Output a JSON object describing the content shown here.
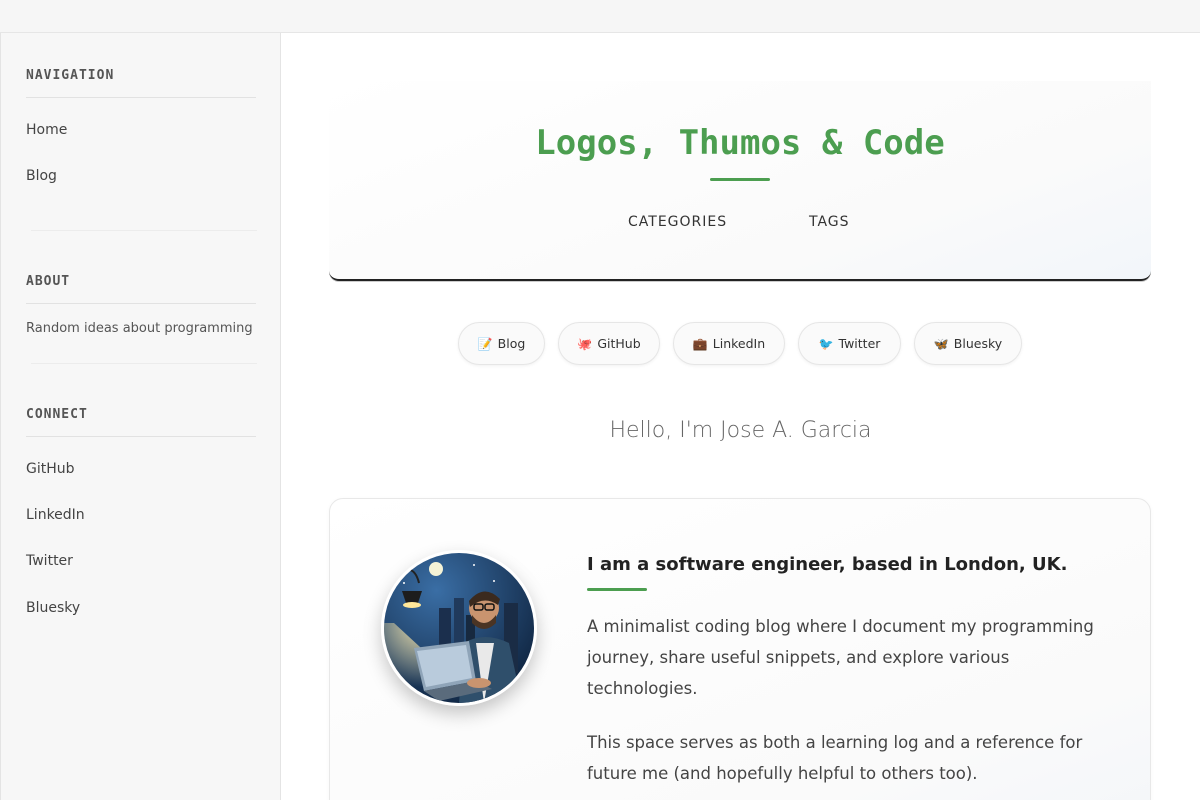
{
  "sidebar": {
    "navigation": {
      "heading": "NAVIGATION",
      "items": [
        "Home",
        "Blog"
      ]
    },
    "about": {
      "heading": "ABOUT",
      "text": "Random ideas about programming"
    },
    "connect": {
      "heading": "CONNECT",
      "items": [
        "GitHub",
        "LinkedIn",
        "Twitter",
        "Bluesky"
      ]
    }
  },
  "header": {
    "title": "Logos, Thumos & Code",
    "nav": [
      "CATEGORIES",
      "TAGS"
    ]
  },
  "social_pills": [
    {
      "icon": "📝",
      "icon_name": "memo-icon",
      "label": "Blog"
    },
    {
      "icon": "🐙",
      "icon_name": "octopus-icon",
      "label": "GitHub"
    },
    {
      "icon": "💼",
      "icon_name": "briefcase-icon",
      "label": "LinkedIn"
    },
    {
      "icon": "🐦",
      "icon_name": "bird-icon",
      "label": "Twitter"
    },
    {
      "icon": "🦋",
      "icon_name": "butterfly-icon",
      "label": "Bluesky"
    }
  ],
  "hello": "Hello, I'm Jose A. Garcia",
  "intro": {
    "heading": "I am a software engineer, based in London, UK.",
    "paragraphs": [
      "A minimalist coding blog where I document my programming journey, share useful snippets, and explore various technologies.",
      "This space serves as both a learning log and a reference for future me (and hopefully helpful to others too)."
    ]
  },
  "colors": {
    "accent": "#4c9e50",
    "text": "#333333",
    "border": "#e4e4e4"
  }
}
